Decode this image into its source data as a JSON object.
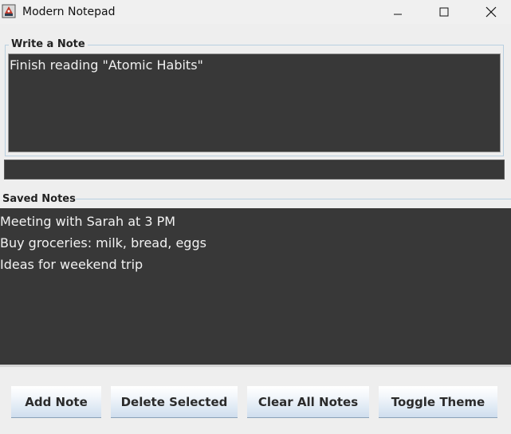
{
  "window": {
    "title": "Modern Notepad",
    "icons": {
      "app": "java-cup-icon",
      "minimize": "minimize-icon",
      "maximize": "maximize-icon",
      "close": "close-icon"
    }
  },
  "write_section": {
    "legend": "Write a Note",
    "textarea_value": "Finish reading \"Atomic Habits\"",
    "input_value": ""
  },
  "saved_section": {
    "legend": "Saved Notes",
    "notes": [
      "Meeting with Sarah at 3 PM",
      "Buy groceries: milk, bread, eggs",
      "Ideas for weekend trip"
    ]
  },
  "buttons": {
    "add": "Add Note",
    "delete": "Delete Selected",
    "clear": "Clear All Notes",
    "toggle": "Toggle Theme"
  },
  "colors": {
    "editor_bg": "#383838",
    "editor_text": "#f0f0f0",
    "window_bg": "#eeeeee",
    "group_border": "#b8cfe0",
    "button_gradient_bottom": "#cfdeee"
  }
}
